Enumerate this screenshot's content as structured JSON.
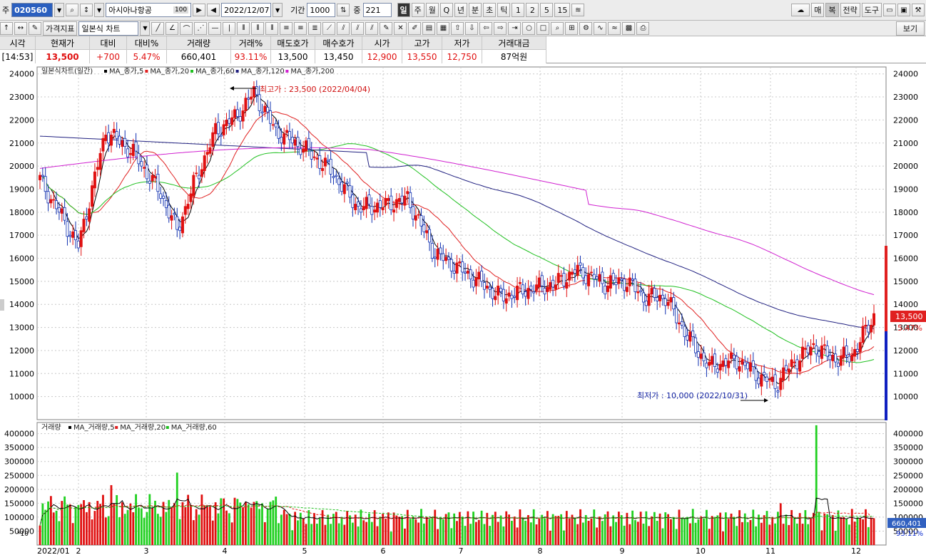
{
  "toolbar": {
    "code_prefix": "주",
    "stock_code": "020560",
    "stock_name": "아시아나항공",
    "stock_badge": "100",
    "date": "2022/12/07",
    "period_label": "기간",
    "period_value": "1000",
    "overlap_label": "중",
    "overlap_value": "221",
    "periods": [
      "일",
      "주",
      "월",
      "Q",
      "년",
      "분",
      "초",
      "틱",
      "1",
      "2",
      "5",
      "15"
    ],
    "right_buttons": [
      "매",
      "복",
      "전략",
      "도구"
    ],
    "indicator_button": "가격지표",
    "chart_type": "일본식 차트",
    "view_button": "보기"
  },
  "quote": {
    "headers": [
      "시각",
      "현재가",
      "대비",
      "대비%",
      "거래량",
      "거래%",
      "매도호가",
      "매수호가",
      "시가",
      "고가",
      "저가",
      "거래대금"
    ],
    "values": [
      "[14:53]",
      "13,500",
      "+700",
      "5.47%",
      "660,401",
      "93.11%",
      "13,500",
      "13,450",
      "12,900",
      "13,550",
      "12,750",
      "87억원"
    ]
  },
  "chart": {
    "legend_title": "일본식차트(일간)",
    "ma_legend": [
      {
        "name": "MA_종가,5",
        "color": "#000000"
      },
      {
        "name": "MA_종가,20",
        "color": "#e02020"
      },
      {
        "name": "MA_종가,60",
        "color": "#20c020"
      },
      {
        "name": "MA_종가,120",
        "color": "#202080"
      },
      {
        "name": "MA_종가,200",
        "color": "#d020d0"
      }
    ],
    "high_annotation": "최고가 : 23,500 (2022/04/04)",
    "low_annotation": "최저가 : 10,000 (2022/10/31)",
    "current_price_label": "13,500",
    "current_change_label": "5.47%",
    "volume_legend_title": "거래량",
    "volume_ma_legend": [
      {
        "name": "MA_거래량,5",
        "color": "#000000"
      },
      {
        "name": "MA_거래량,20",
        "color": "#e02020"
      },
      {
        "name": "MA_거래량,60",
        "color": "#20c020"
      }
    ],
    "volume_unit": "*10",
    "current_volume_label": "660,401",
    "current_volume_pct": "93.11%",
    "x_labels": [
      "2022/01",
      "2",
      "3",
      "4",
      "5",
      "6",
      "7",
      "8",
      "9",
      "10",
      "11",
      "12"
    ],
    "price_ticks": [
      "24000",
      "23000",
      "22000",
      "21000",
      "20000",
      "19000",
      "18000",
      "17000",
      "16000",
      "15000",
      "14000",
      "13000",
      "12000",
      "11000",
      "10000"
    ],
    "volume_ticks": [
      "400000",
      "350000",
      "300000",
      "250000",
      "200000",
      "150000",
      "100000",
      "50000"
    ]
  },
  "chart_data": {
    "type": "candlestick",
    "x": [
      "2022/01",
      "2",
      "3",
      "4",
      "5",
      "6",
      "7",
      "8",
      "9",
      "10",
      "11",
      "12"
    ],
    "price_range": [
      9000,
      24300
    ],
    "volume_range": [
      0,
      440000
    ],
    "monthly_close_approx": [
      16600,
      21300,
      17800,
      22500,
      19700,
      18300,
      14500,
      15000,
      14300,
      11200,
      11900,
      13500
    ],
    "high": {
      "price": 23500,
      "date": "2022/04/04"
    },
    "low": {
      "price": 10000,
      "date": "2022/10/31"
    },
    "last": {
      "close": 13500,
      "open": 12900,
      "high": 13550,
      "low": 12750,
      "volume": 660401
    }
  }
}
